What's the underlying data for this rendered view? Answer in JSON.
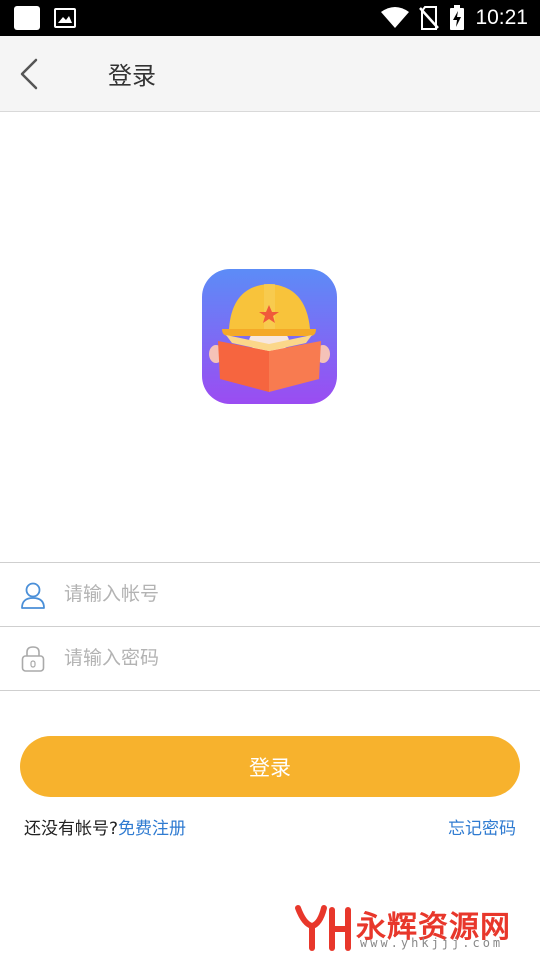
{
  "status_bar": {
    "time": "10:21",
    "icons": [
      "notification-square-icon",
      "image-icon",
      "wifi-icon",
      "no-sim-icon",
      "battery-charging-icon"
    ]
  },
  "header": {
    "back_icon": "chevron-left-icon",
    "title": "登录"
  },
  "app_logo": {
    "icon": "helmet-book-logo",
    "colors": {
      "gradient_top": "#5c8cf7",
      "gradient_bottom": "#9b4cf2",
      "helmet": "#f8c33b",
      "book": "#f6653f"
    }
  },
  "form": {
    "account": {
      "icon": "user-icon",
      "placeholder": "请输入帐号",
      "value": ""
    },
    "password": {
      "icon": "lock-icon",
      "placeholder": "请输入密码",
      "value": ""
    },
    "login_button": "登录"
  },
  "links": {
    "no_account": "还没有帐号?",
    "register": "免费注册",
    "forgot_password": "忘记密码"
  },
  "watermark": {
    "brand": "永辉资源网",
    "url": "www.yhkjjj.com"
  },
  "colors": {
    "accent": "#f7b22d",
    "link": "#2f7bd1",
    "header_bg": "#f5f5f5"
  }
}
